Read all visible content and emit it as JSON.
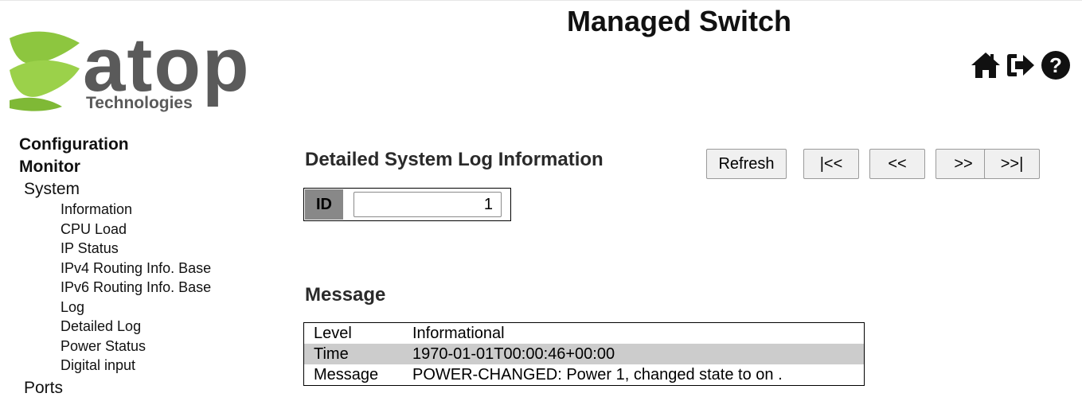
{
  "header": {
    "title": "Managed Switch",
    "logo": {
      "word": "atop",
      "tagline": "Technologies"
    },
    "icons": [
      "home-icon",
      "logout-icon",
      "help-icon"
    ]
  },
  "sidebar": {
    "items": [
      {
        "label": "Configuration",
        "level": 1
      },
      {
        "label": "Monitor",
        "level": 1
      },
      {
        "label": "System",
        "level": 2
      },
      {
        "label": "Information",
        "level": 3
      },
      {
        "label": "CPU Load",
        "level": 3
      },
      {
        "label": "IP Status",
        "level": 3
      },
      {
        "label": "IPv4 Routing Info. Base",
        "level": 3
      },
      {
        "label": "IPv6 Routing Info. Base",
        "level": 3
      },
      {
        "label": "Log",
        "level": 3
      },
      {
        "label": "Detailed Log",
        "level": 3
      },
      {
        "label": "Power Status",
        "level": 3
      },
      {
        "label": "Digital input",
        "level": 3
      },
      {
        "label": "Ports",
        "level": 2
      }
    ]
  },
  "main": {
    "heading": "Detailed System Log Information",
    "buttons": {
      "refresh": "Refresh",
      "first": "|<<",
      "prev": "<<",
      "next": ">>",
      "last": ">>|"
    },
    "id_label": "ID",
    "id_value": "1",
    "message_heading": "Message",
    "message": {
      "level_label": "Level",
      "level_value": "Informational",
      "time_label": "Time",
      "time_value": "1970-01-01T00:00:46+00:00",
      "message_label": "Message",
      "message_value": "POWER-CHANGED: Power 1, changed state to on ."
    }
  },
  "colors": {
    "logo_green": "#8dc63f",
    "logo_dark": "#5a5a5a",
    "id_label_bg": "#888888",
    "row_shade": "#cccccc"
  }
}
